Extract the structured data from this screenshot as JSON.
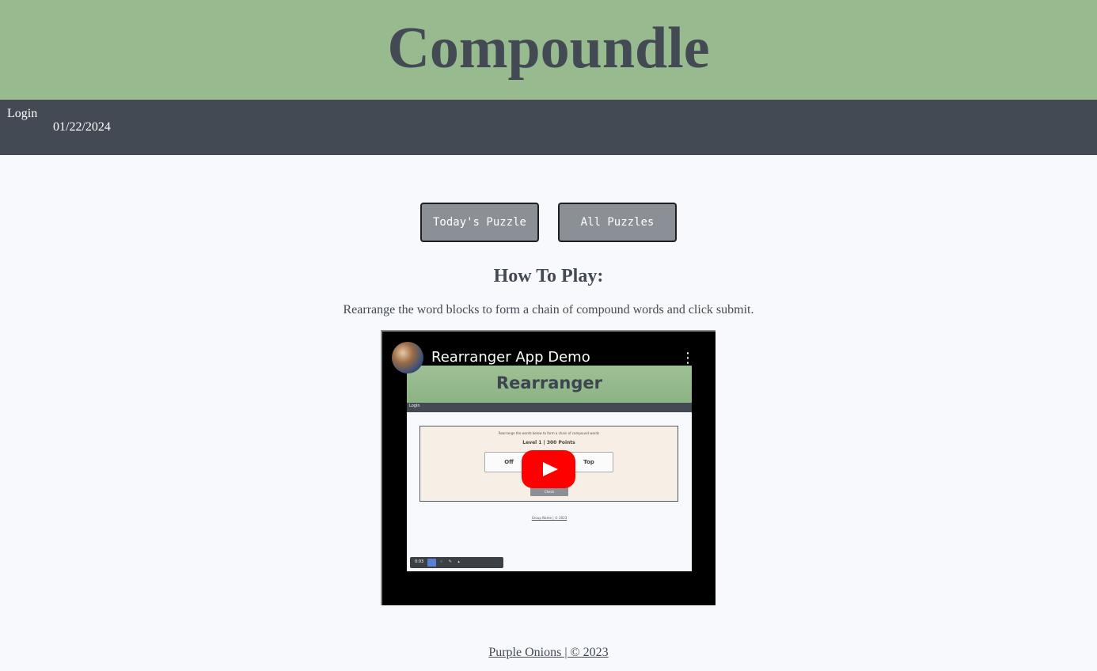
{
  "header": {
    "title": "Compoundle"
  },
  "nav": {
    "login_label": "Login",
    "date": "01/22/2024"
  },
  "actions": {
    "today_label": "Today's Puzzle",
    "all_label": "All Puzzles"
  },
  "how_to": {
    "title": "How To Play:",
    "description": "Rearrange the word blocks to form a chain of compound words and click submit."
  },
  "video": {
    "title": "Rearranger App Demo",
    "menu_icon": "⋮",
    "thumbnail": {
      "app_title": "Rearranger",
      "login_label": "Login",
      "instructions": "Rearrange the words below to form a chain of compound words",
      "level_text": "Level 1 | 300 Points",
      "block_1": "Off",
      "block_2": "Top",
      "check_label": "Check",
      "footer_text": "Group Name | © 2023",
      "time": "0:03",
      "tools": "☝ ✎ ▴"
    }
  },
  "footer": {
    "text": "Purple Onions | © 2023"
  },
  "colors": {
    "header_bg": "#97bb8f",
    "nav_bg": "#434a54",
    "page_bg": "#f8f9fd",
    "button_bg": "#8a9096",
    "play_red": "#ff0000"
  }
}
